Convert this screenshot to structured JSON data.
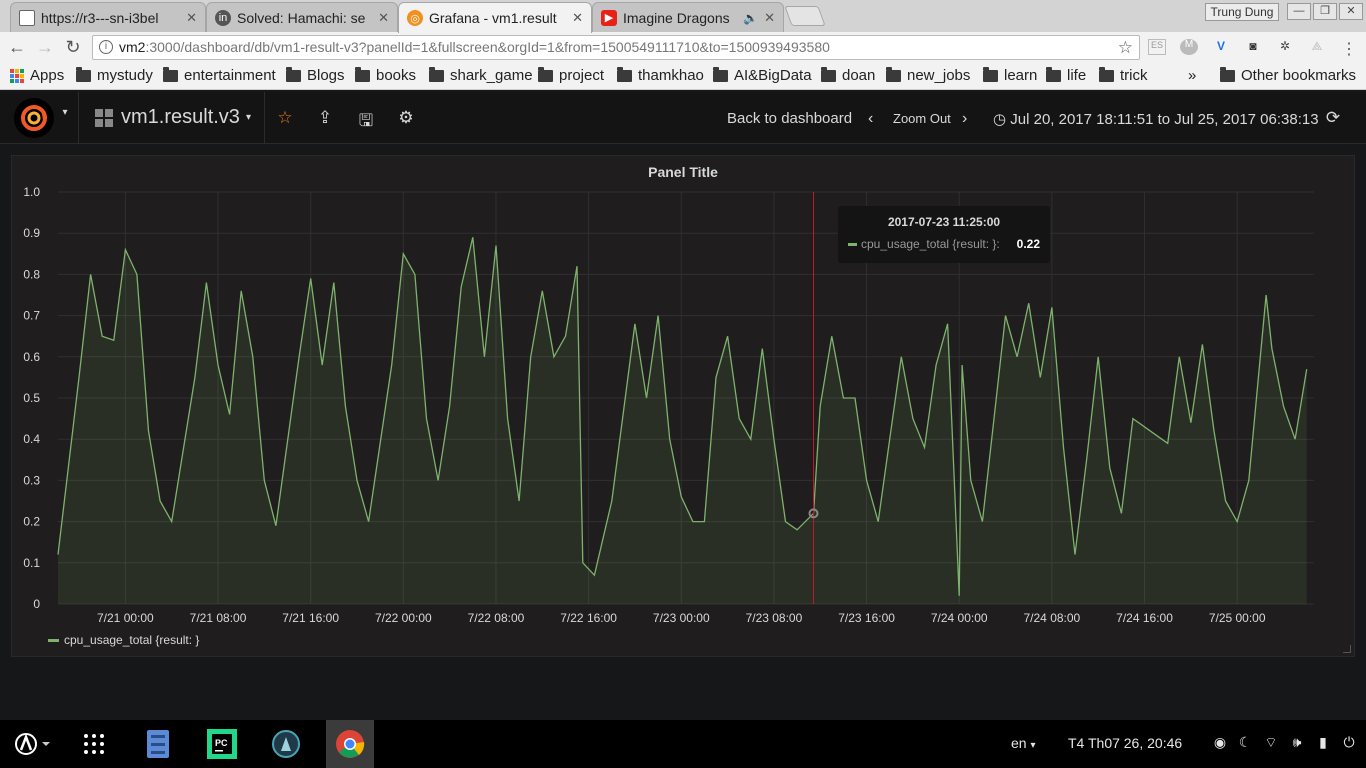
{
  "browser": {
    "tabs": [
      {
        "title": "https://r3---sn-i3bel",
        "favicon": "page-icon",
        "active": false
      },
      {
        "title": "Solved: Hamachi: se",
        "favicon": "linkedin-icon",
        "active": false
      },
      {
        "title": "Grafana - vm1.result",
        "favicon": "grafana-icon",
        "active": true
      },
      {
        "title": "Imagine Dragons",
        "favicon": "youtube-icon",
        "active": false,
        "audio": true
      }
    ],
    "window_user": "Trung Dung",
    "address": {
      "host": "vm2",
      "rest": ":3000/dashboard/db/vm1-result-v3?panelId=1&fullscreen&orgId=1&from=1500549111710&to=1500939493580"
    },
    "extensions": [
      "es-icon",
      "m-icon",
      "vimeo-icon",
      "pocket-icon",
      "gear-extension-icon",
      "triangle-extension-icon"
    ],
    "bookmarks": [
      "Apps",
      "mystudy",
      "entertainment",
      "Blogs",
      "books",
      "shark_game",
      "project",
      "thamkhao",
      "AI&BigData",
      "doan",
      "new_jobs",
      "learn",
      "life",
      "trick"
    ],
    "overflow": "»",
    "other_bookmarks": "Other bookmarks"
  },
  "grafana": {
    "dashboard_name": "vm1.result.v3",
    "back_label": "Back to dashboard",
    "zoom_out_label": "Zoom Out",
    "time_range": "Jul 20, 2017 18:11:51 to Jul 25, 2017 06:38:13",
    "panel": {
      "title": "Panel Title",
      "legend": "cpu_usage_total {result: }",
      "tooltip": {
        "time": "2017-07-23 11:25:00",
        "series": "cpu_usage_total {result: }:",
        "value": "0.22"
      }
    },
    "colors": {
      "series": "#7eb26d",
      "cursor": "#c4162a",
      "panel_bg": "#1f1d1d",
      "page_bg": "#161719"
    }
  },
  "chart_data": {
    "type": "area",
    "title": "Panel Title",
    "xlabel": "",
    "ylabel": "",
    "ylim": [
      0,
      1.0
    ],
    "yticks": [
      "0",
      "0.1",
      "0.2",
      "0.3",
      "0.4",
      "0.5",
      "0.6",
      "0.7",
      "0.8",
      "0.9",
      "1.0"
    ],
    "xlim": [
      "2017-07-20 18:11",
      "2017-07-25 06:38"
    ],
    "xticks": [
      "7/21 00:00",
      "7/21 08:00",
      "7/21 16:00",
      "7/22 00:00",
      "7/22 08:00",
      "7/22 16:00",
      "7/23 00:00",
      "7/23 08:00",
      "7/23 16:00",
      "7/24 00:00",
      "7/24 08:00",
      "7/24 16:00",
      "7/25 00:00"
    ],
    "grid": true,
    "legend": "bottom-left",
    "cursor_time": "2017-07-23 11:25",
    "series": [
      {
        "name": "cpu_usage_total {result: }",
        "points": [
          [
            "2017-07-20 18:11",
            0.12
          ],
          [
            "2017-07-20 20:00",
            0.55
          ],
          [
            "2017-07-20 21:00",
            0.8
          ],
          [
            "2017-07-20 22:00",
            0.65
          ],
          [
            "2017-07-20 23:00",
            0.64
          ],
          [
            "2017-07-21 00:00",
            0.86
          ],
          [
            "2017-07-21 01:00",
            0.8
          ],
          [
            "2017-07-21 02:00",
            0.42
          ],
          [
            "2017-07-21 03:00",
            0.25
          ],
          [
            "2017-07-21 04:00",
            0.2
          ],
          [
            "2017-07-21 06:00",
            0.55
          ],
          [
            "2017-07-21 07:00",
            0.78
          ],
          [
            "2017-07-21 08:00",
            0.58
          ],
          [
            "2017-07-21 09:00",
            0.46
          ],
          [
            "2017-07-21 10:00",
            0.76
          ],
          [
            "2017-07-21 11:00",
            0.6
          ],
          [
            "2017-07-21 12:00",
            0.3
          ],
          [
            "2017-07-21 13:00",
            0.19
          ],
          [
            "2017-07-21 15:00",
            0.6
          ],
          [
            "2017-07-21 16:00",
            0.79
          ],
          [
            "2017-07-21 17:00",
            0.58
          ],
          [
            "2017-07-21 18:00",
            0.78
          ],
          [
            "2017-07-21 19:00",
            0.48
          ],
          [
            "2017-07-21 20:00",
            0.3
          ],
          [
            "2017-07-21 21:00",
            0.2
          ],
          [
            "2017-07-21 23:00",
            0.58
          ],
          [
            "2017-07-22 00:00",
            0.85
          ],
          [
            "2017-07-22 01:00",
            0.8
          ],
          [
            "2017-07-22 02:00",
            0.45
          ],
          [
            "2017-07-22 03:00",
            0.3
          ],
          [
            "2017-07-22 04:00",
            0.48
          ],
          [
            "2017-07-22 05:00",
            0.77
          ],
          [
            "2017-07-22 06:00",
            0.89
          ],
          [
            "2017-07-22 07:00",
            0.6
          ],
          [
            "2017-07-22 08:00",
            0.87
          ],
          [
            "2017-07-22 09:00",
            0.45
          ],
          [
            "2017-07-22 10:00",
            0.25
          ],
          [
            "2017-07-22 11:00",
            0.6
          ],
          [
            "2017-07-22 12:00",
            0.76
          ],
          [
            "2017-07-22 13:00",
            0.6
          ],
          [
            "2017-07-22 14:00",
            0.65
          ],
          [
            "2017-07-22 15:00",
            0.82
          ],
          [
            "2017-07-22 15:30",
            0.1
          ],
          [
            "2017-07-22 16:30",
            0.07
          ],
          [
            "2017-07-22 18:00",
            0.25
          ],
          [
            "2017-07-22 20:00",
            0.68
          ],
          [
            "2017-07-22 21:00",
            0.5
          ],
          [
            "2017-07-22 22:00",
            0.7
          ],
          [
            "2017-07-22 23:00",
            0.4
          ],
          [
            "2017-07-23 00:00",
            0.26
          ],
          [
            "2017-07-23 01:00",
            0.2
          ],
          [
            "2017-07-23 02:00",
            0.2
          ],
          [
            "2017-07-23 03:00",
            0.55
          ],
          [
            "2017-07-23 04:00",
            0.65
          ],
          [
            "2017-07-23 05:00",
            0.45
          ],
          [
            "2017-07-23 06:00",
            0.4
          ],
          [
            "2017-07-23 07:00",
            0.62
          ],
          [
            "2017-07-23 08:00",
            0.4
          ],
          [
            "2017-07-23 09:00",
            0.2
          ],
          [
            "2017-07-23 10:00",
            0.18
          ],
          [
            "2017-07-23 11:25",
            0.22
          ],
          [
            "2017-07-23 12:00",
            0.48
          ],
          [
            "2017-07-23 13:00",
            0.65
          ],
          [
            "2017-07-23 14:00",
            0.5
          ],
          [
            "2017-07-23 15:00",
            0.5
          ],
          [
            "2017-07-23 16:00",
            0.3
          ],
          [
            "2017-07-23 17:00",
            0.2
          ],
          [
            "2017-07-23 18:00",
            0.4
          ],
          [
            "2017-07-23 19:00",
            0.6
          ],
          [
            "2017-07-23 20:00",
            0.45
          ],
          [
            "2017-07-23 21:00",
            0.38
          ],
          [
            "2017-07-23 22:00",
            0.58
          ],
          [
            "2017-07-23 23:00",
            0.68
          ],
          [
            "2017-07-24 00:00",
            0.02
          ],
          [
            "2017-07-24 00:15",
            0.58
          ],
          [
            "2017-07-24 01:00",
            0.3
          ],
          [
            "2017-07-24 02:00",
            0.2
          ],
          [
            "2017-07-24 03:00",
            0.45
          ],
          [
            "2017-07-24 04:00",
            0.7
          ],
          [
            "2017-07-24 05:00",
            0.6
          ],
          [
            "2017-07-24 06:00",
            0.73
          ],
          [
            "2017-07-24 07:00",
            0.55
          ],
          [
            "2017-07-24 08:00",
            0.72
          ],
          [
            "2017-07-24 09:00",
            0.38
          ],
          [
            "2017-07-24 10:00",
            0.12
          ],
          [
            "2017-07-24 11:00",
            0.35
          ],
          [
            "2017-07-24 12:00",
            0.6
          ],
          [
            "2017-07-24 13:00",
            0.33
          ],
          [
            "2017-07-24 14:00",
            0.22
          ],
          [
            "2017-07-24 15:00",
            0.45
          ],
          [
            "2017-07-24 18:00",
            0.39
          ],
          [
            "2017-07-24 19:00",
            0.6
          ],
          [
            "2017-07-24 20:00",
            0.44
          ],
          [
            "2017-07-24 21:00",
            0.63
          ],
          [
            "2017-07-24 22:00",
            0.42
          ],
          [
            "2017-07-24 23:00",
            0.25
          ],
          [
            "2017-07-25 00:00",
            0.2
          ],
          [
            "2017-07-25 01:00",
            0.3
          ],
          [
            "2017-07-25 02:00",
            0.6
          ],
          [
            "2017-07-25 02:30",
            0.75
          ],
          [
            "2017-07-25 03:00",
            0.62
          ],
          [
            "2017-07-25 04:00",
            0.48
          ],
          [
            "2017-07-25 05:00",
            0.4
          ],
          [
            "2017-07-25 06:00",
            0.57
          ]
        ]
      }
    ]
  },
  "taskbar": {
    "apps": [
      "launcher-icon",
      "app-grid-icon",
      "file-manager-icon",
      "pycharm-icon",
      "kodi-icon",
      "chrome-icon"
    ],
    "lang": "en",
    "clock": "T4 Th07 26, 20:46",
    "tray": [
      "display-icon",
      "night-mode-icon",
      "wifi-icon",
      "volume-icon",
      "battery-icon",
      "power-icon"
    ]
  }
}
